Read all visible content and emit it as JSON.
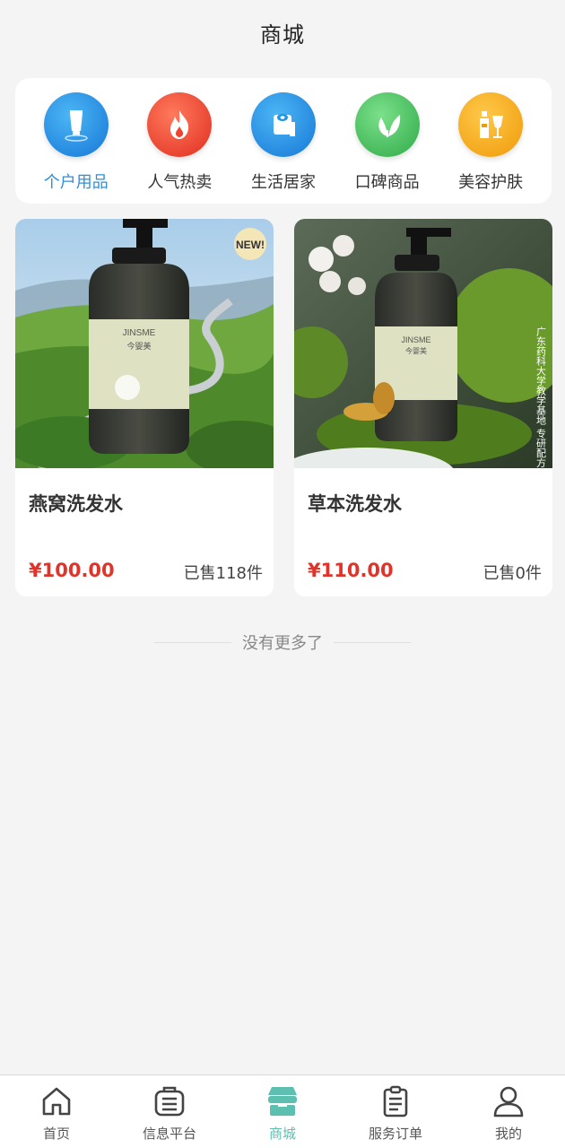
{
  "header": {
    "title": "商城"
  },
  "categories": [
    {
      "label": "个户用品",
      "icon": "lotion-tube-icon",
      "color": "#1e96e8",
      "active": true
    },
    {
      "label": "人气热卖",
      "icon": "fire-icon",
      "color": "#f0432f",
      "active": false
    },
    {
      "label": "生活居家",
      "icon": "toilet-roll-icon",
      "color": "#1e96e8",
      "active": false
    },
    {
      "label": "口碑商品",
      "icon": "leaf-icon",
      "color": "#3fc25a",
      "active": false
    },
    {
      "label": "美容护肤",
      "icon": "bottle-glass-icon",
      "color": "#f3a512",
      "active": false
    }
  ],
  "products": [
    {
      "name": "燕窝洗发水",
      "price": "¥100.00",
      "sold": "已售118件",
      "image_badge": "NEW!",
      "brand_label": "JINSME",
      "brand_cn": "今婴美"
    },
    {
      "name": "草本洗发水",
      "price": "¥110.00",
      "sold": "已售0件",
      "brand_label": "JINSME",
      "brand_cn": "今婴美",
      "image_side_text": "广东药科大学教学基地 专研配方"
    }
  ],
  "footer_note": "没有更多了",
  "tabs": [
    {
      "label": "首页",
      "icon": "home-icon",
      "active": false
    },
    {
      "label": "信息平台",
      "icon": "clipboard-list-icon",
      "active": false
    },
    {
      "label": "商城",
      "icon": "shop-icon",
      "active": true
    },
    {
      "label": "服务订单",
      "icon": "order-document-icon",
      "active": false
    },
    {
      "label": "我的",
      "icon": "user-icon",
      "active": false
    }
  ],
  "colors": {
    "accent_blue": "#2f8fd8",
    "price_red": "#e0342b",
    "tab_active": "#5dbfb0"
  }
}
